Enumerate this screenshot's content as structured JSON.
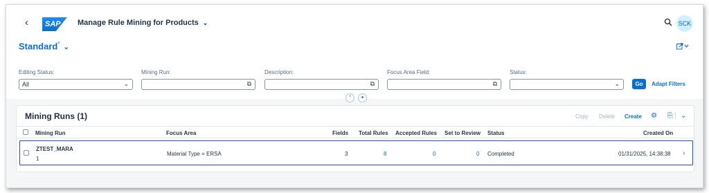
{
  "shell": {
    "back_glyph": "‹",
    "logo_text": "SAP",
    "title": "Manage Rule Mining for Products",
    "title_chevron": "⌄",
    "search_icon": "search-icon",
    "avatar": "SCK"
  },
  "header": {
    "variant": "Standard",
    "variant_modified": "*",
    "share_icon": "share-icon"
  },
  "filters": [
    {
      "label": "Editing Status:",
      "value": "All",
      "type": "select"
    },
    {
      "label": "Mining Run:",
      "value": "",
      "type": "valuehelp"
    },
    {
      "label": "Description:",
      "value": "",
      "type": "valuehelp"
    },
    {
      "label": "Focus Area Field:",
      "value": "",
      "type": "valuehelp"
    },
    {
      "label": "Status:",
      "value": "",
      "type": "select"
    }
  ],
  "filter_actions": {
    "go": "Go",
    "adapt": "Adapt Filters"
  },
  "table": {
    "title": "Mining Runs (1)",
    "toolbar": {
      "copy": "Copy",
      "delete": "Delete",
      "create": "Create"
    },
    "columns": [
      "Mining Run",
      "Focus Area",
      "Fields",
      "Total Rules",
      "Accepted Rules",
      "Set to Review",
      "Status",
      "Created On"
    ],
    "rows": [
      {
        "mining_run": "ZTEST_MARA",
        "mining_run_sub": "1",
        "focus_area": "Material Type = ERSA",
        "fields": "3",
        "total_rules": "8",
        "accepted_rules": "0",
        "set_to_review": "0",
        "status": "Completed",
        "created_on": "01/31/2025, 14:38:38"
      }
    ]
  },
  "colors": {
    "accent": "#0a6ed1",
    "selection": "#1d4ed1",
    "background": "#f5f6f7"
  }
}
